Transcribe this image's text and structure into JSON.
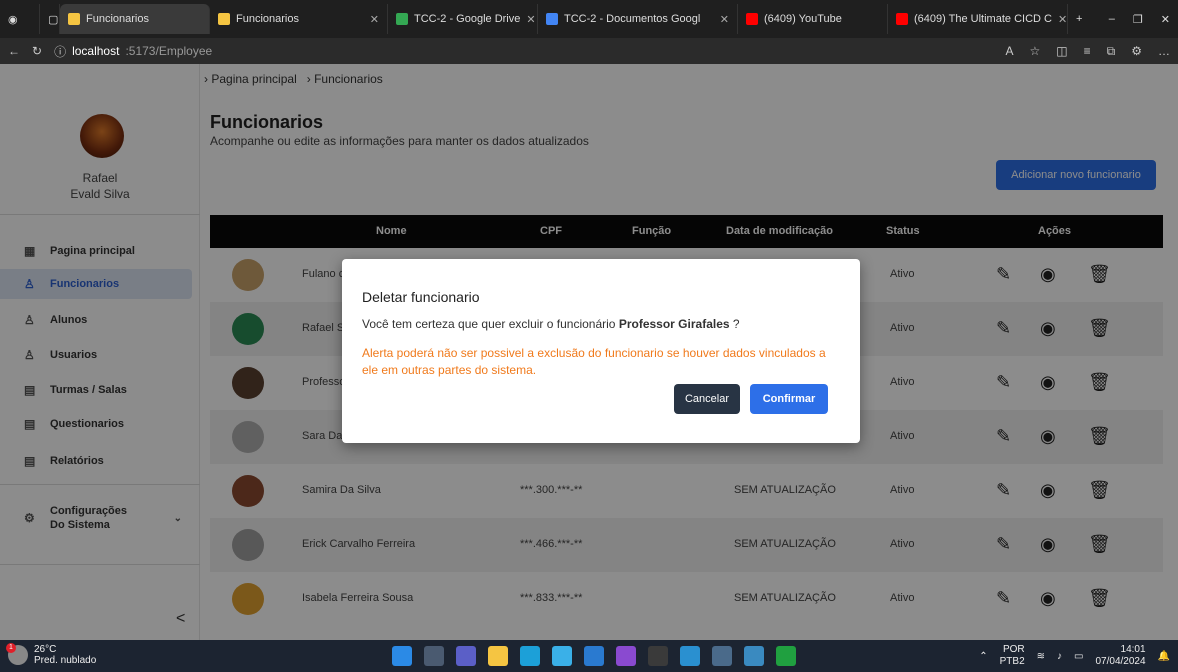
{
  "browser": {
    "tabs": [
      {
        "label": "Funcionarios",
        "color": "#f5c542"
      },
      {
        "label": "Funcionarios",
        "color": "#f5c542"
      },
      {
        "label": "TCC-2 - Google Drive",
        "color": "#34a853"
      },
      {
        "label": "TCC-2 - Documentos Googl",
        "color": "#4285f4"
      },
      {
        "label": "(6409) YouTube",
        "color": "#ff0000"
      },
      {
        "label": "(6409) The Ultimate CICD C",
        "color": "#ff0000"
      }
    ],
    "url_host": "localhost",
    "url_path": ":5173/Employee"
  },
  "sidebar": {
    "user_first": "Rafael",
    "user_last": "Evald Silva",
    "items": [
      {
        "label": "Pagina principal",
        "icon": "grid-icon"
      },
      {
        "label": "Funcionarios",
        "icon": "user-icon"
      },
      {
        "label": "Alunos",
        "icon": "user-icon"
      },
      {
        "label": "Usuarios",
        "icon": "user-icon"
      },
      {
        "label": "Turmas / Salas",
        "icon": "document-icon"
      },
      {
        "label": "Questionarios",
        "icon": "document-icon"
      },
      {
        "label": "Relatórios",
        "icon": "document-icon"
      },
      {
        "label": "Configurações Do Sistema",
        "icon": "gear-icon"
      }
    ],
    "collapse_glyph": "<"
  },
  "breadcrumb": {
    "home": "Pagina principal",
    "current": "Funcionarios"
  },
  "page": {
    "title": "Funcionarios",
    "subtitle": "Acompanhe ou edite as informações para manter os dados atualizados",
    "add_button": "Adicionar novo funcionario"
  },
  "table": {
    "headers": {
      "name": "Nome",
      "cpf": "CPF",
      "role": "Função",
      "modified": "Data de modificação",
      "status": "Status",
      "actions": "Ações"
    },
    "rows": [
      {
        "name": "Fulano c",
        "cpf": "",
        "modified": "",
        "status": "Ativo",
        "avatar": "#c9a36b"
      },
      {
        "name": "Rafael S",
        "cpf": "",
        "modified": "",
        "status": "Ativo",
        "avatar": "#2a8a55"
      },
      {
        "name": "Professo",
        "cpf": "",
        "modified": "",
        "status": "Ativo",
        "avatar": "#5a4030"
      },
      {
        "name": "Sara Da",
        "cpf": "",
        "modified": "",
        "status": "Ativo",
        "avatar": "#b0b0b0"
      },
      {
        "name": "Samira Da Silva",
        "cpf": "***.300.***-**",
        "modified": "SEM ATUALIZAÇÃO",
        "status": "Ativo",
        "avatar": "#8a4a30"
      },
      {
        "name": "Erick Carvalho Ferreira",
        "cpf": "***.466.***-**",
        "modified": "SEM ATUALIZAÇÃO",
        "status": "Ativo",
        "avatar": "#a0a0a0"
      },
      {
        "name": "Isabela Ferreira Sousa",
        "cpf": "***.833.***-**",
        "modified": "SEM ATUALIZAÇÃO",
        "status": "Ativo",
        "avatar": "#e0a030"
      }
    ]
  },
  "modal": {
    "title": "Deletar funcionario",
    "question_prefix": "Você tem certeza que quer excluir o funcionário",
    "employee": "Professor Girafales",
    "question_suffix": "?",
    "warning": "Alerta poderá não ser possivel a exclusão do funcionario se houver dados vinculados a ele em outras partes do sistema.",
    "cancel": "Cancelar",
    "confirm": "Confirmar"
  },
  "taskbar": {
    "temp": "26°C",
    "weather": "Pred. nublado",
    "badge": "1",
    "lang": "POR",
    "lang2": "PTB2",
    "time": "14:01",
    "date": "07/04/2024"
  }
}
